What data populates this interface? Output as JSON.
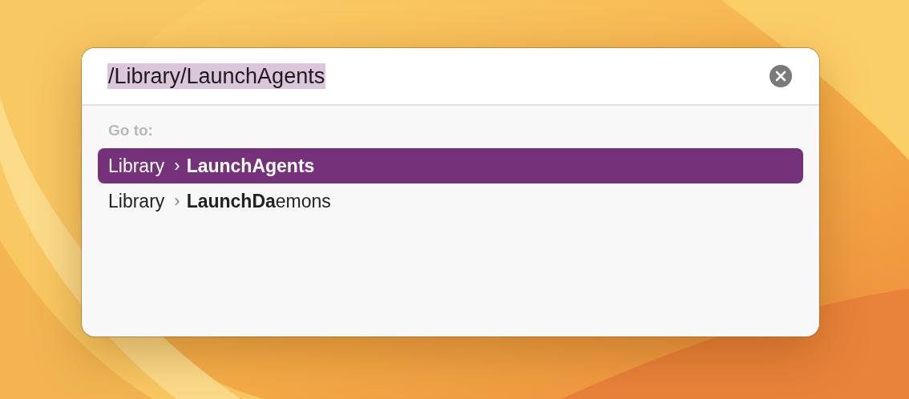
{
  "path_field": {
    "value": "/Library/LaunchAgents",
    "selected": true
  },
  "section_label": "Go to:",
  "results": [
    {
      "parent": "Library",
      "separator": "›",
      "name": "**LaunchAgents**",
      "selected": true
    },
    {
      "parent": "Library",
      "separator": "›",
      "name": "**LaunchDa**emons",
      "selected": false
    }
  ]
}
